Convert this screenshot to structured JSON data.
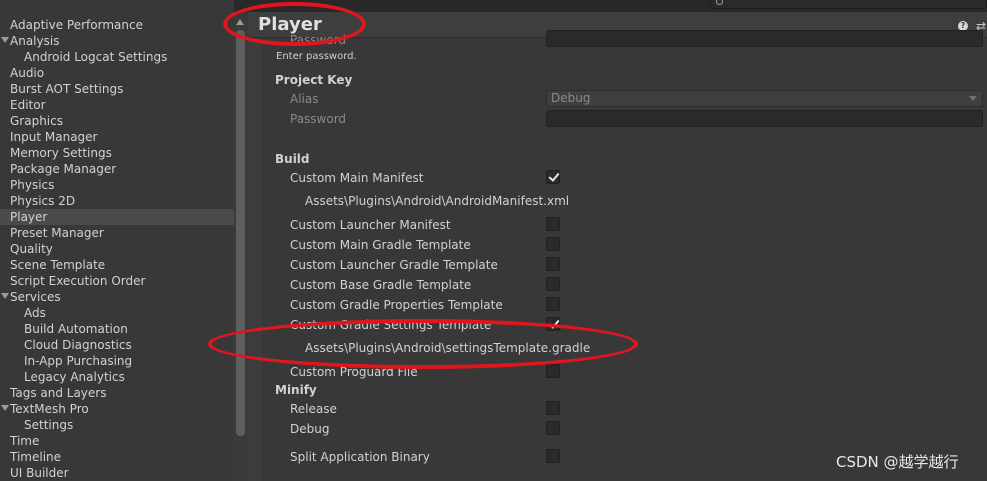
{
  "sidebar": {
    "items": [
      {
        "label": "Adaptive Performance",
        "indent": 0
      },
      {
        "label": "Analysis",
        "indent": 0,
        "expanded": true
      },
      {
        "label": "Android Logcat Settings",
        "indent": 1
      },
      {
        "label": "Audio",
        "indent": 0
      },
      {
        "label": "Burst AOT Settings",
        "indent": 0
      },
      {
        "label": "Editor",
        "indent": 0
      },
      {
        "label": "Graphics",
        "indent": 0
      },
      {
        "label": "Input Manager",
        "indent": 0
      },
      {
        "label": "Memory Settings",
        "indent": 0
      },
      {
        "label": "Package Manager",
        "indent": 0
      },
      {
        "label": "Physics",
        "indent": 0
      },
      {
        "label": "Physics 2D",
        "indent": 0
      },
      {
        "label": "Player",
        "indent": 0,
        "selected": true
      },
      {
        "label": "Preset Manager",
        "indent": 0
      },
      {
        "label": "Quality",
        "indent": 0
      },
      {
        "label": "Scene Template",
        "indent": 0
      },
      {
        "label": "Script Execution Order",
        "indent": 0
      },
      {
        "label": "Services",
        "indent": 0,
        "expanded": true
      },
      {
        "label": "Ads",
        "indent": 1
      },
      {
        "label": "Build Automation",
        "indent": 1
      },
      {
        "label": "Cloud Diagnostics",
        "indent": 1
      },
      {
        "label": "In-App Purchasing",
        "indent": 1
      },
      {
        "label": "Legacy Analytics",
        "indent": 1
      },
      {
        "label": "Tags and Layers",
        "indent": 0
      },
      {
        "label": "TextMesh Pro",
        "indent": 0,
        "expanded": true
      },
      {
        "label": "Settings",
        "indent": 1
      },
      {
        "label": "Time",
        "indent": 0
      },
      {
        "label": "Timeline",
        "indent": 0
      },
      {
        "label": "UI Builder",
        "indent": 0
      }
    ]
  },
  "header": {
    "title": "Player",
    "help_icon": "?",
    "preset_icon": "⇄"
  },
  "keystore": {
    "password_label": "Password",
    "hint": "Enter password."
  },
  "project_key": {
    "section": "Project Key",
    "alias_label": "Alias",
    "alias_value": "Debug",
    "password_label": "Password"
  },
  "build": {
    "section": "Build",
    "custom_main_manifest": {
      "label": "Custom Main Manifest",
      "checked": true,
      "path": "Assets\\Plugins\\Android\\AndroidManifest.xml"
    },
    "custom_launcher_manifest": {
      "label": "Custom Launcher Manifest",
      "checked": false
    },
    "custom_main_gradle": {
      "label": "Custom Main Gradle Template",
      "checked": false
    },
    "custom_launcher_gradle": {
      "label": "Custom Launcher Gradle Template",
      "checked": false
    },
    "custom_base_gradle": {
      "label": "Custom Base Gradle Template",
      "checked": false
    },
    "custom_gradle_properties": {
      "label": "Custom Gradle Properties Template",
      "checked": false
    },
    "custom_gradle_settings": {
      "label": "Custom Gradle Settings Template",
      "checked": true,
      "path": "Assets\\Plugins\\Android\\settingsTemplate.gradle"
    },
    "custom_proguard": {
      "label": "Custom Proguard File",
      "checked": false
    }
  },
  "minify": {
    "section": "Minify",
    "release": {
      "label": "Release",
      "checked": false
    },
    "debug": {
      "label": "Debug",
      "checked": false
    }
  },
  "split_binary": {
    "label": "Split Application Binary",
    "checked": false
  },
  "watermark": "CSDN @越学越行",
  "colors": {
    "background": "#383838",
    "selected_row": "#4b4b4b",
    "annotation": "#e0161e"
  }
}
